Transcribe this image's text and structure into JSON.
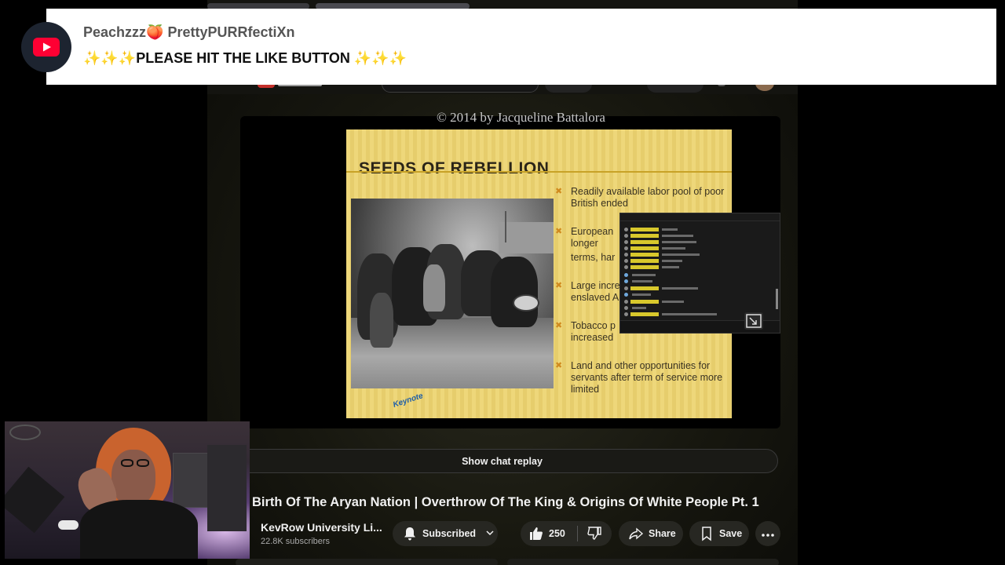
{
  "notification": {
    "username": "Peachzzz🍑 PrettyPURRfectiXn",
    "message": "✨✨✨PLEASE HIT THE LIKE BUTTON ✨✨✨",
    "avatar_icon": "youtube-logo-icon",
    "avatar_bg": "#1d2430",
    "accent": "#ff0033"
  },
  "slide": {
    "copyright": "© 2014 by Jacqueline Battalora",
    "title": "SEEDS OF REBELLION",
    "bullets": [
      [
        "Readily available labor pool of poor",
        "British ended"
      ],
      [
        "European",
        "longer",
        " terms, har"
      ],
      [
        "Large incre",
        "enslaved A"
      ],
      [
        "Tobacco p",
        "increased"
      ],
      [
        "Land and other opportunities for",
        "servants after term of service more",
        "limited"
      ]
    ],
    "logo_text": "Keynote",
    "background": "#eed77a"
  },
  "player": {
    "chat_replay_label": "Show chat replay"
  },
  "video": {
    "title": "Birth Of The Aryan Nation | Overthrow Of The King & Origins Of White People Pt. 1",
    "channel": "KevRow University Li...",
    "subscribers": "22.8K subscribers",
    "subscribe_label": "Subscribed",
    "likes": "250",
    "share_label": "Share",
    "save_label": "Save"
  },
  "icons": {
    "subscribe": "bell-icon",
    "like": "thumbs-up-icon",
    "dislike": "thumbs-down-icon",
    "share": "share-arrow-icon",
    "save": "bookmark-icon",
    "more": "more-horizontal-icon",
    "expand": "expand-icon"
  }
}
